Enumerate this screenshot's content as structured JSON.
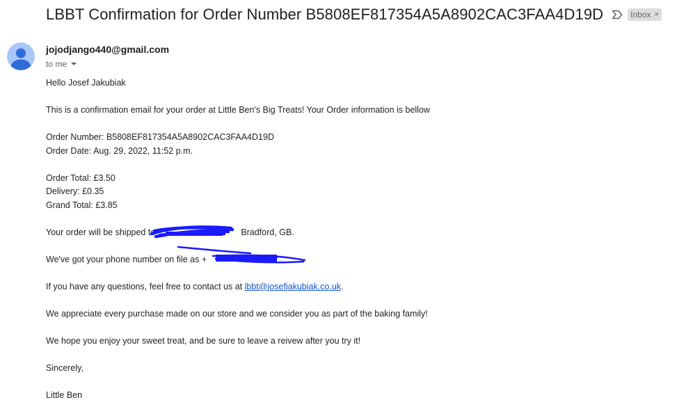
{
  "email": {
    "subject": "LBBT Confirmation for Order Number B5808EF817354A5A8902CAC3FAA4D19D",
    "label_chip": "Inbox",
    "label_chip_close": "×",
    "sender": "jojodjango440@gmail.com",
    "recipient": "to me",
    "greeting": "Hello Josef Jakubiak",
    "intro": "This is a confirmation email for your order at Little Ben's Big Treats! Your Order information is bellow",
    "order_number_line": "Order Number: B5808EF817354A5A8902CAC3FAA4D19D",
    "order_date_line": "Order Date: Aug. 29, 2022, 11:52 p.m.",
    "order_total_line": "Order Total: £3.50",
    "delivery_line": "Delivery: £0.35",
    "grand_total_line": "Grand Total: £3.85",
    "shipping_prefix": "Your order will be shipped to",
    "shipping_suffix": "Bradford, GB.",
    "phone_prefix": "We've got your phone number on file as +",
    "contact_prefix": "If you have any questions, feel free to contact us at ",
    "contact_email": "lbbt@josefjakubiak.co.uk",
    "contact_suffix": ".",
    "appreciate": "We appreciate every purchase made on our store and we consider you as part of the baking family!",
    "enjoy": "We hope you enjoy your sweet treat, and be sure to leave a reivew after you try it!",
    "signoff": "Sincerely,",
    "signature": "Little Ben"
  },
  "icons": {
    "important": "important-marker-icon",
    "avatar": "person-avatar-icon",
    "details": "chevron-down-icon"
  },
  "colors": {
    "chip_bg": "#dddddd",
    "link": "#1155cc",
    "avatar_bg": "#a8c7fa",
    "avatar_figure": "#2f6bd8",
    "redaction": "#1a1aff"
  }
}
